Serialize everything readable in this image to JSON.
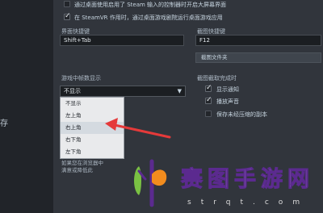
{
  "sidebar": {
    "partial_item": "存"
  },
  "top_options": [
    {
      "label": "通过桌面使用启用了 Steam 输入的控制器时开启大屏幕界面",
      "checked": false
    },
    {
      "label": "在 SteamVR 作用时，通过桌面游戏剧院运行桌面游戏应用",
      "checked": true
    }
  ],
  "overlay_shortcut": {
    "label": "界面快捷键",
    "value": "Shift+Tab"
  },
  "screenshot_shortcut": {
    "label": "截图快捷键",
    "value": "F12",
    "folder_button": "截图文件夹"
  },
  "fps_counter": {
    "label": "游戏中帧数显示",
    "selected": "不显示",
    "options": [
      "不显示",
      "左上角",
      "右上角",
      "右下角",
      "左下角"
    ],
    "highlighted_index": 2
  },
  "screenshot_actions": {
    "label": "截图截取完成时",
    "options": [
      {
        "label": "显示通知",
        "checked": true
      },
      {
        "label": "播放声音",
        "checked": true
      },
      {
        "label": "保存未经压缩的副本",
        "checked": false
      }
    ]
  },
  "note_text": {
    "line1": "如果您在浏览器中",
    "line2": "满意或降低此"
  },
  "watermark": {
    "chars": [
      "赛",
      "图",
      "手",
      "游",
      "网"
    ],
    "letters": "strqt.com",
    "colors": {
      "green": "#7ac143",
      "orange": "#f28c1e",
      "purple": "#5b2a8f"
    }
  },
  "colors": {
    "arrow": "#e53a3a",
    "background": "#31353c"
  }
}
